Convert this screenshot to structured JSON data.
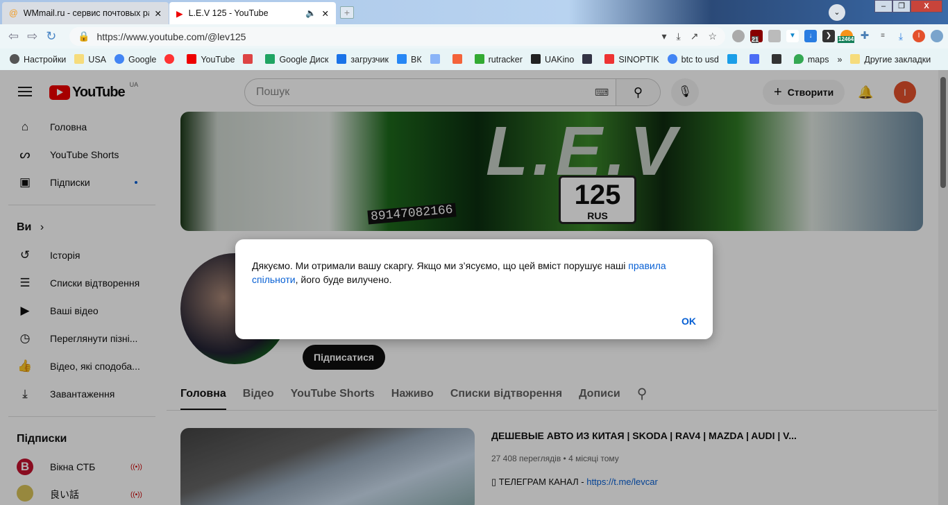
{
  "browser": {
    "tabs": [
      {
        "title": "WMmail.ru - сервис почтовых рас",
        "active": false
      },
      {
        "title": "L.E.V 125 - YouTube",
        "active": true
      }
    ],
    "url": "https://www.youtube.com/@lev125",
    "extensions": {
      "ublock_count": "21",
      "btc_badge": "12464",
      "profile_initial": "I"
    },
    "bookmarks": [
      "Настройки",
      "USA",
      "Google",
      "",
      "YouTube",
      "",
      "Google Диск",
      "загрузчик",
      "ВК",
      "",
      "",
      "rutracker",
      "UAKino",
      "",
      "SINOPTIK",
      "btc to usd",
      "",
      "",
      "",
      "maps",
      "»",
      "Другие закладки"
    ]
  },
  "youtube": {
    "logo_text": "YouTube",
    "region": "UA",
    "search_placeholder": "Пошук",
    "create_label": "Створити",
    "avatar_initial": "I",
    "sidebar": {
      "main": [
        {
          "label": "Головна",
          "icon": "home-icon"
        },
        {
          "label": "YouTube Shorts",
          "icon": "shorts-icon"
        },
        {
          "label": "Підписки",
          "icon": "subscriptions-icon"
        }
      ],
      "you_heading": "Ви",
      "you": [
        {
          "label": "Історія"
        },
        {
          "label": "Списки відтворення"
        },
        {
          "label": "Ваші відео"
        },
        {
          "label": "Переглянути пізні..."
        },
        {
          "label": "Відео, які сподоба..."
        },
        {
          "label": "Завантаження"
        }
      ],
      "subs_heading": "Підписки",
      "subs": [
        {
          "label": "Вікна СТБ",
          "color": "#c4122f"
        },
        {
          "label": "良い話",
          "color": "#d9c35a"
        }
      ]
    },
    "banner": {
      "title": "L.E.V",
      "plate": "125",
      "plate_region": "RUS",
      "phone": "89147082166"
    },
    "subscribe_label": "Підписатися",
    "channel_tabs": [
      "Головна",
      "Відео",
      "YouTube Shorts",
      "Наживо",
      "Списки відтворення",
      "Дописи"
    ],
    "video": {
      "title": "ДЕШЕВЫЕ АВТО ИЗ КИТАЯ | SKODA | RAV4 | MAZDA | AUDI | V...",
      "meta": "27 408 переглядів • 4 місяці тому",
      "desc_prefix": "▯ ТЕЛЕГРАМ КАНАЛ  - ",
      "desc_link": "https://t.me/levcar"
    }
  },
  "dialog": {
    "text_before": "Дякуємо. Ми отримали вашу скаргу. Якщо ми з’ясуємо, що цей вміст порушує наші ",
    "link": "правила спільноти",
    "text_after": ", його буде вилучено.",
    "ok_label": "OK"
  }
}
